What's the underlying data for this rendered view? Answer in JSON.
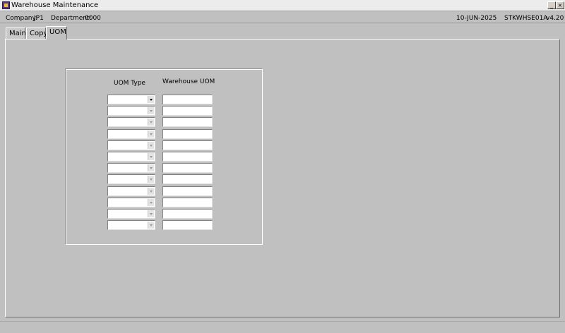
{
  "window": {
    "title": "Warehouse Maintenance",
    "minimize_glyph": "_",
    "close_glyph": "×"
  },
  "info": {
    "company_label": "Company:",
    "company_value": "JP1",
    "department_label": "Department:",
    "department_value": "0000",
    "date": "10-JUN-2025",
    "program": "STKWHSE01A",
    "version": "v4.20"
  },
  "tabs": [
    {
      "label": "Main"
    },
    {
      "label": "Copy"
    },
    {
      "label": "UOM"
    }
  ],
  "uom_form": {
    "uom_type_header": "UOM Type",
    "warehouse_uom_header": "Warehouse UOM",
    "rows": [
      {
        "uom_type": "",
        "warehouse_uom": ""
      },
      {
        "uom_type": "",
        "warehouse_uom": ""
      },
      {
        "uom_type": "",
        "warehouse_uom": ""
      },
      {
        "uom_type": "",
        "warehouse_uom": ""
      },
      {
        "uom_type": "",
        "warehouse_uom": ""
      },
      {
        "uom_type": "",
        "warehouse_uom": ""
      },
      {
        "uom_type": "",
        "warehouse_uom": ""
      },
      {
        "uom_type": "",
        "warehouse_uom": ""
      },
      {
        "uom_type": "",
        "warehouse_uom": ""
      },
      {
        "uom_type": "",
        "warehouse_uom": ""
      },
      {
        "uom_type": "",
        "warehouse_uom": ""
      },
      {
        "uom_type": "",
        "warehouse_uom": ""
      }
    ]
  }
}
